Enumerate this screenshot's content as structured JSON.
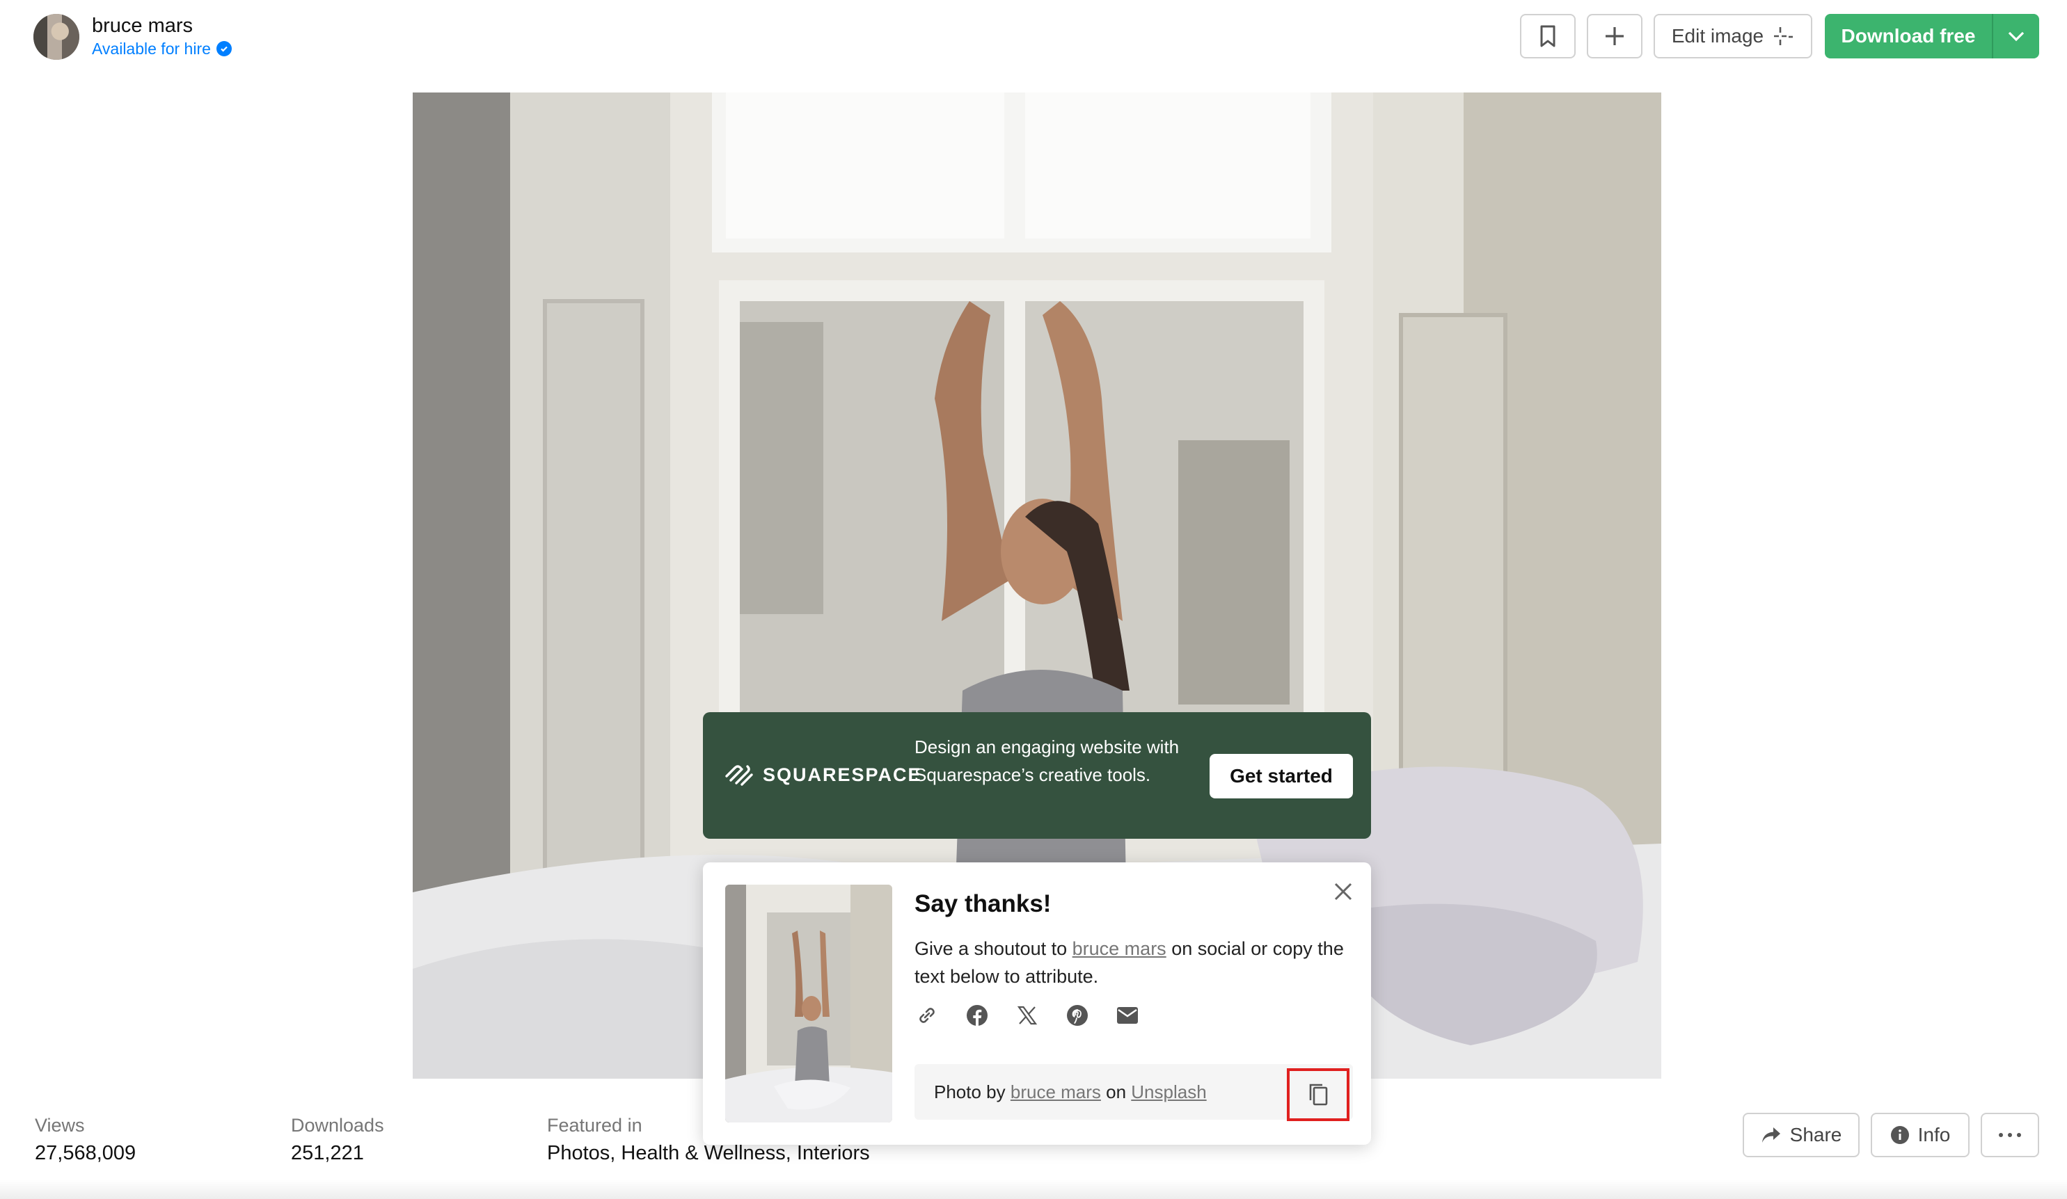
{
  "header": {
    "user_name": "bruce mars",
    "hire_label": "Available for hire",
    "edit_label": "Edit image",
    "download_label": "Download free"
  },
  "ad": {
    "brand": "SQUARESPACE",
    "text": "Design an engaging website with Squarespace’s creative tools.",
    "cta": "Get started"
  },
  "thanks": {
    "title": "Say thanks!",
    "desc_prefix": "Give a shoutout to ",
    "desc_link": "bruce mars",
    "desc_suffix": " on social or copy the text below to attribute.",
    "attr_prefix": "Photo by ",
    "attr_author": "bruce mars",
    "attr_mid": " on ",
    "attr_site": "Unsplash"
  },
  "stats": {
    "views_label": "Views",
    "views_value": "27,568,009",
    "downloads_label": "Downloads",
    "downloads_value": "251,221",
    "featured_label": "Featured in",
    "featured_value": "Photos, Health & Wellness, Interiors"
  },
  "actions": {
    "share": "Share",
    "info": "Info"
  },
  "colors": {
    "download_green": "#3cb46e",
    "ad_green": "#35523f",
    "verified_blue": "#007fff",
    "highlight_red": "#e0201f"
  }
}
